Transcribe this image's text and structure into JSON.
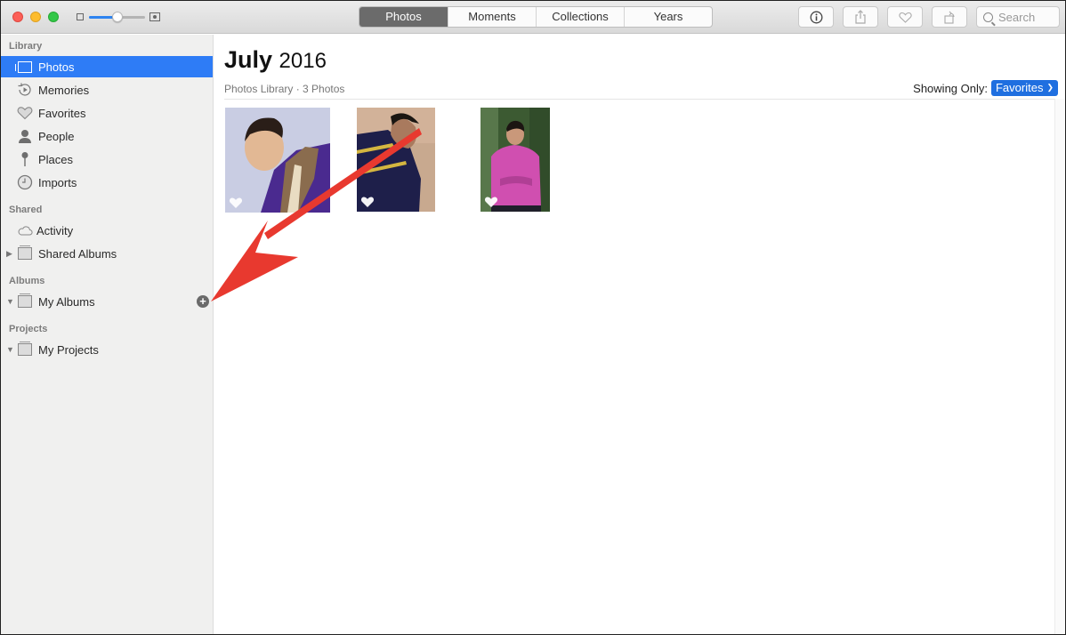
{
  "toolbar": {
    "tabs": [
      {
        "label": "Photos",
        "active": true
      },
      {
        "label": "Moments",
        "active": false
      },
      {
        "label": "Collections",
        "active": false
      },
      {
        "label": "Years",
        "active": false
      }
    ],
    "zoom_slider_value": 0.5,
    "buttons": {
      "info": "info-icon",
      "share": "share-icon",
      "favorite": "heart-icon",
      "rotate": "rotate-icon"
    },
    "search_placeholder": "Search"
  },
  "sidebar": {
    "sections": {
      "library": "Library",
      "shared": "Shared",
      "albums": "Albums",
      "projects": "Projects"
    },
    "library_items": [
      {
        "label": "Photos",
        "icon": "photos-icon",
        "selected": true
      },
      {
        "label": "Memories",
        "icon": "memories-icon",
        "selected": false
      },
      {
        "label": "Favorites",
        "icon": "heart-icon",
        "selected": false
      },
      {
        "label": "People",
        "icon": "person-icon",
        "selected": false
      },
      {
        "label": "Places",
        "icon": "pin-icon",
        "selected": false
      },
      {
        "label": "Imports",
        "icon": "clock-icon",
        "selected": false
      }
    ],
    "shared_items": [
      {
        "label": "Activity",
        "icon": "cloud-icon"
      },
      {
        "label": "Shared Albums",
        "icon": "album-icon",
        "disclosure": "collapsed"
      }
    ],
    "albums_items": [
      {
        "label": "My Albums",
        "icon": "album-icon",
        "disclosure": "expanded"
      }
    ],
    "projects_items": [
      {
        "label": "My Projects",
        "icon": "album-icon",
        "disclosure": "expanded"
      }
    ],
    "add_album_glyph": "+"
  },
  "main": {
    "title_month": "July",
    "title_year": "2016",
    "subtitle": "Photos Library · 3 Photos",
    "showing_only_label": "Showing Only:",
    "filter_value": "Favorites",
    "photos": [
      {
        "description": "man in purple kurta with embroidered vest",
        "favorite": true,
        "colors": {
          "bg": "#c9cde3",
          "main": "#4a2a8f",
          "accent": "#8a6c4e"
        }
      },
      {
        "description": "man in navy striped shirt looking down",
        "favorite": true,
        "colors": {
          "bg": "#c8a98f",
          "main": "#1e1f4a",
          "accent": "#d4b640"
        }
      },
      {
        "description": "man in pink sweater standing among trees",
        "favorite": true,
        "colors": {
          "bg": "#3c5a32",
          "main": "#d04fb0",
          "accent": "#6b8a5c"
        }
      }
    ]
  },
  "annotation": {
    "type": "arrow",
    "color": "#e8392f",
    "points_to": "add-album-button"
  }
}
